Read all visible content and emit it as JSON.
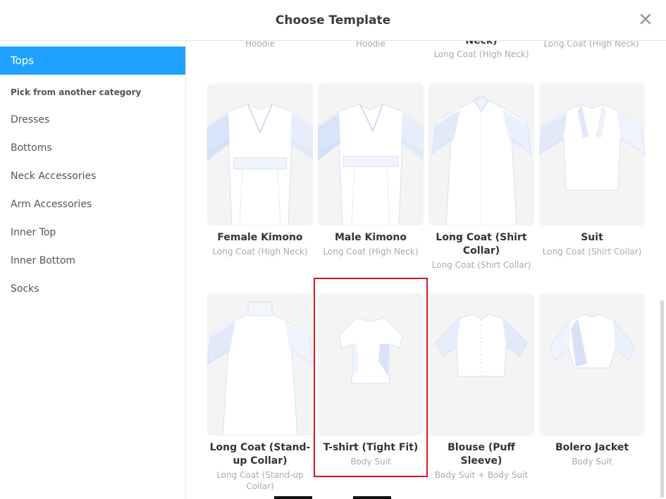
{
  "dialog": {
    "title": "Choose Template",
    "close_glyph": "×"
  },
  "sidebar": {
    "active": "Tops",
    "subheading": "Pick from another category",
    "items": [
      "Dresses",
      "Bottoms",
      "Neck Accessories",
      "Arm Accessories",
      "Inner Top",
      "Inner Bottom",
      "Socks"
    ]
  },
  "top_row": [
    {
      "name": "",
      "sub": "Hoodie"
    },
    {
      "name": "",
      "sub": "Hoodie"
    },
    {
      "name": "Neck)",
      "sub": "Long Coat (High Neck)"
    },
    {
      "name": "",
      "sub": "Long Coat (High Neck)"
    }
  ],
  "row1": [
    {
      "name": "Female Kimono",
      "sub": "Long Coat (High Neck)",
      "icon": "kimono-icon"
    },
    {
      "name": "Male Kimono",
      "sub": "Long Coat (High Neck)",
      "icon": "kimono-icon"
    },
    {
      "name": "Long Coat (Shirt Collar)",
      "sub": "Long Coat (Shirt Collar)",
      "icon": "long-coat-icon"
    },
    {
      "name": "Suit",
      "sub": "Long Coat (Shirt Collar)",
      "icon": "suit-jacket-icon"
    }
  ],
  "row2": [
    {
      "name": "Long Coat (Stand-up Collar)",
      "sub": "Long Coat (Stand-up Collar)",
      "icon": "standup-coat-icon"
    },
    {
      "name": "T-shirt (Tight Fit)",
      "sub": "Body Suit",
      "icon": "tshirt-icon"
    },
    {
      "name": "Blouse (Puff Sleeve)",
      "sub": "Body Suit + Body Suit",
      "icon": "blouse-icon"
    },
    {
      "name": "Bolero Jacket",
      "sub": "Body Suit",
      "icon": "bolero-icon"
    }
  ],
  "colors": {
    "accent": "#1fa2ff",
    "selection": "#d9141d",
    "thumb_bg": "#f4f4f4",
    "garment_shade": "#c9d8f6"
  }
}
